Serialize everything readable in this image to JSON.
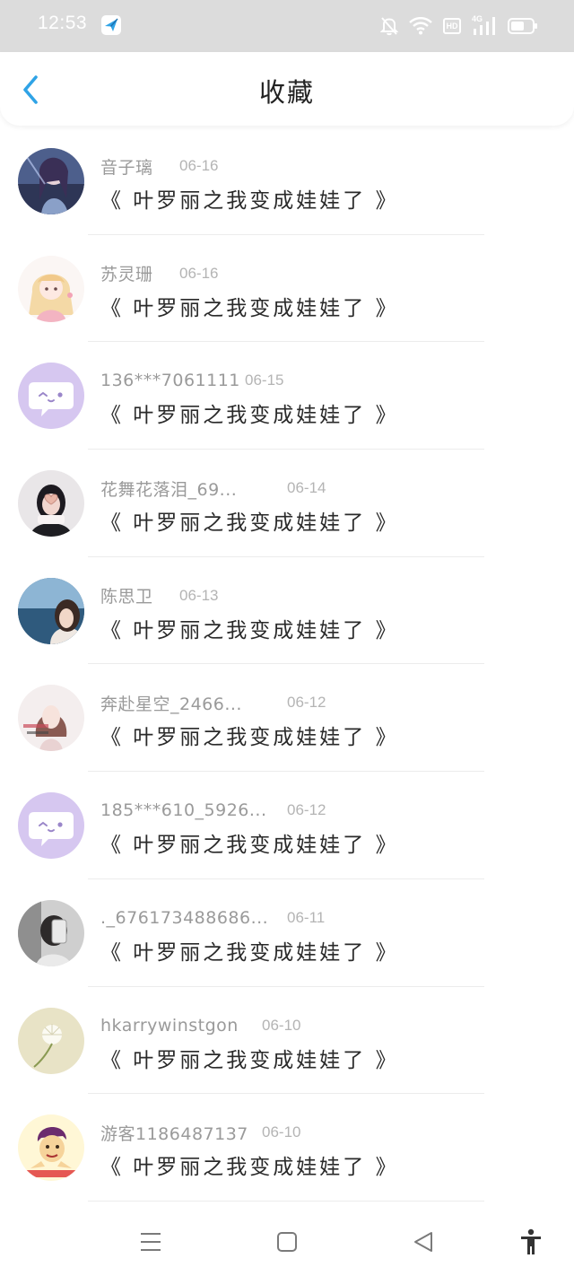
{
  "status_bar": {
    "time": "12:53",
    "icons": [
      "app-notification-icon",
      "mute-icon",
      "wifi-icon",
      "hd-icon",
      "signal-4g-icon",
      "battery-icon"
    ],
    "hd_label": "HD",
    "network_label": "4G"
  },
  "header": {
    "title": "收藏",
    "back_icon": "chevron-left-icon",
    "accent_color": "#2fa3e6"
  },
  "favorites": [
    {
      "name": "音子璃",
      "date": "06-16",
      "title": "《 叶罗丽之我变成娃娃了 》",
      "avatar": "anime-character"
    },
    {
      "name": "苏灵珊",
      "date": "06-16",
      "title": "《 叶罗丽之我变成娃娃了 》",
      "avatar": "anime-girl"
    },
    {
      "name": "136***7061111",
      "date": "06-15",
      "title": "《 叶罗丽之我变成娃娃了 》",
      "avatar": "default-chat"
    },
    {
      "name": "花舞花落泪_69...",
      "date": "06-14",
      "title": "《 叶罗丽之我变成娃娃了 》",
      "avatar": "heart-hands-photo"
    },
    {
      "name": "陈思卫",
      "date": "06-13",
      "title": "《 叶罗丽之我变成娃娃了 》",
      "avatar": "sea-photo"
    },
    {
      "name": "奔赴星空_2466...",
      "date": "06-12",
      "title": "《 叶罗丽之我变成娃娃了 》",
      "avatar": "girl-sketch"
    },
    {
      "name": "185***610_5926...",
      "date": "06-12",
      "title": "《 叶罗丽之我变成娃娃了 》",
      "avatar": "default-chat"
    },
    {
      "name": "._676173488686...",
      "date": "06-11",
      "title": "《 叶罗丽之我变成娃娃了 》",
      "avatar": "mirror-selfie"
    },
    {
      "name": "hkarrywinstgon",
      "date": "06-10",
      "title": "《 叶罗丽之我变成娃娃了 》",
      "avatar": "dandelion"
    },
    {
      "name": "游客1186487137",
      "date": "06-10",
      "title": "《 叶罗丽之我变成娃娃了 》",
      "avatar": "cartoon-meme"
    }
  ],
  "nav_bar": {
    "buttons": [
      "menu-icon",
      "home-square-icon",
      "back-triangle-icon",
      "accessibility-icon"
    ]
  }
}
